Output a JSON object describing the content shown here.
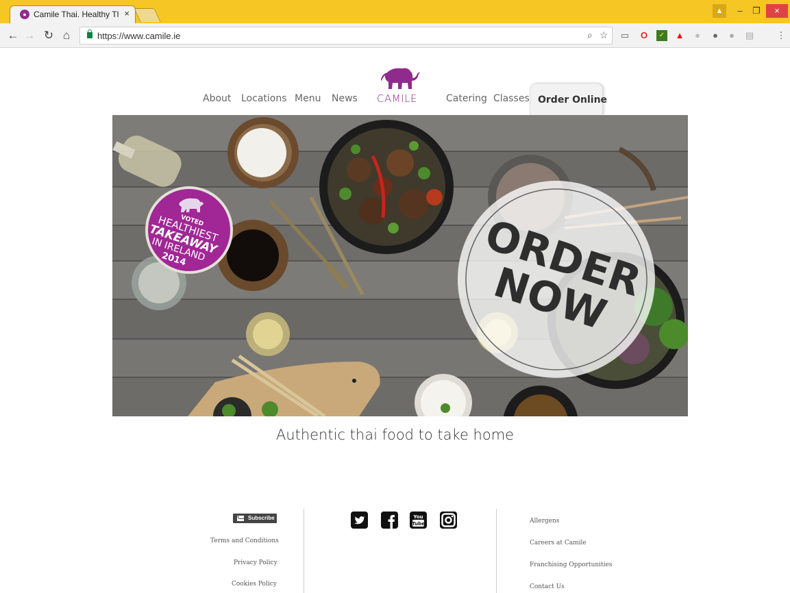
{
  "browser": {
    "tab_title": "Camile Thai. Healthy Tha",
    "tab_close": "×",
    "url": "https://www.camile.ie",
    "win_minimize": "–",
    "win_maximize": "❐",
    "win_close": "×"
  },
  "toolbar_icons": [
    "back-icon",
    "forward-icon",
    "reload-icon",
    "home-icon",
    "lock-icon",
    "zoom-icon",
    "star-icon",
    "cast-icon",
    "opera-icon",
    "extension-check-icon",
    "adobe-icon",
    "extension-icon",
    "extension-icon",
    "extension-icon",
    "menu-icon"
  ],
  "site": {
    "nav_left": [
      "About",
      "Locations",
      "Menu",
      "News"
    ],
    "logo_text": "CAMILE",
    "nav_right": [
      "Catering",
      "Classes"
    ],
    "order_online": "Order Online",
    "brand_color": "#8e2b8c"
  },
  "hero": {
    "badge_voted": "VOTED",
    "badge_healthiest": "HEALTHIEST",
    "badge_takeaway": "TAKEAWAY",
    "badge_ireland": "IN IRELAND",
    "badge_year": "2014",
    "order_line1": "ORDER",
    "order_line2": "NOW"
  },
  "tagline": "Authentic thai food to take home",
  "footer": {
    "subscribe": "Subscribe",
    "left_links": [
      "Terms and Conditions",
      "Privacy Policy",
      "Cookies Policy"
    ],
    "social_icons": [
      "twitter-icon",
      "facebook-icon",
      "youtube-icon",
      "instagram-icon"
    ],
    "youtube_label_top": "You",
    "youtube_label_bottom": "Tube",
    "right_links": [
      "Allergens",
      "Careers at Camile",
      "Franchising Opportunities",
      "Contact Us"
    ]
  }
}
